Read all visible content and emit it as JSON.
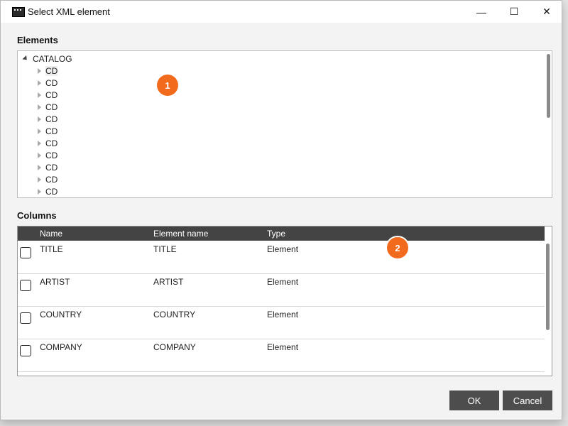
{
  "window": {
    "title": "Select XML element",
    "minimize": "—",
    "maximize": "☐",
    "close": "✕"
  },
  "elements": {
    "label": "Elements",
    "root": "CATALOG",
    "items": [
      "CD",
      "CD",
      "CD",
      "CD",
      "CD",
      "CD",
      "CD",
      "CD",
      "CD",
      "CD",
      "CD"
    ]
  },
  "columns": {
    "label": "Columns",
    "headers": {
      "name": "Name",
      "element_name": "Element name",
      "type": "Type"
    },
    "rows": [
      {
        "name": "TITLE",
        "element_name": "TITLE",
        "type": "Element",
        "checked": false
      },
      {
        "name": "ARTIST",
        "element_name": "ARTIST",
        "type": "Element",
        "checked": false
      },
      {
        "name": "COUNTRY",
        "element_name": "COUNTRY",
        "type": "Element",
        "checked": false
      },
      {
        "name": "COMPANY",
        "element_name": "COMPANY",
        "type": "Element",
        "checked": false
      }
    ]
  },
  "badges": {
    "one": "1",
    "two": "2"
  },
  "buttons": {
    "ok": "OK",
    "cancel": "Cancel"
  },
  "colors": {
    "badge": "#f26b1d",
    "header": "#444444",
    "button": "#4d4d4d"
  }
}
